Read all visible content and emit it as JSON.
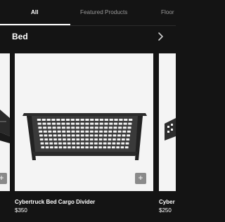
{
  "tabs": [
    {
      "label": "All",
      "active": true
    },
    {
      "label": "Featured Products",
      "active": false
    },
    {
      "label": "Floor",
      "active": false
    }
  ],
  "section": {
    "title": "Bed"
  },
  "products": [
    {
      "name": "Cybertruck Bed Cargo Divider",
      "price": "$350"
    },
    {
      "name": "Cyber",
      "price": "$250"
    }
  ],
  "icons": {
    "next": "chevron-right-icon",
    "add": "plus-icon"
  },
  "colors": {
    "background": "#141414",
    "card": "#f4f4f4",
    "add_button": "#8a8a8a"
  }
}
